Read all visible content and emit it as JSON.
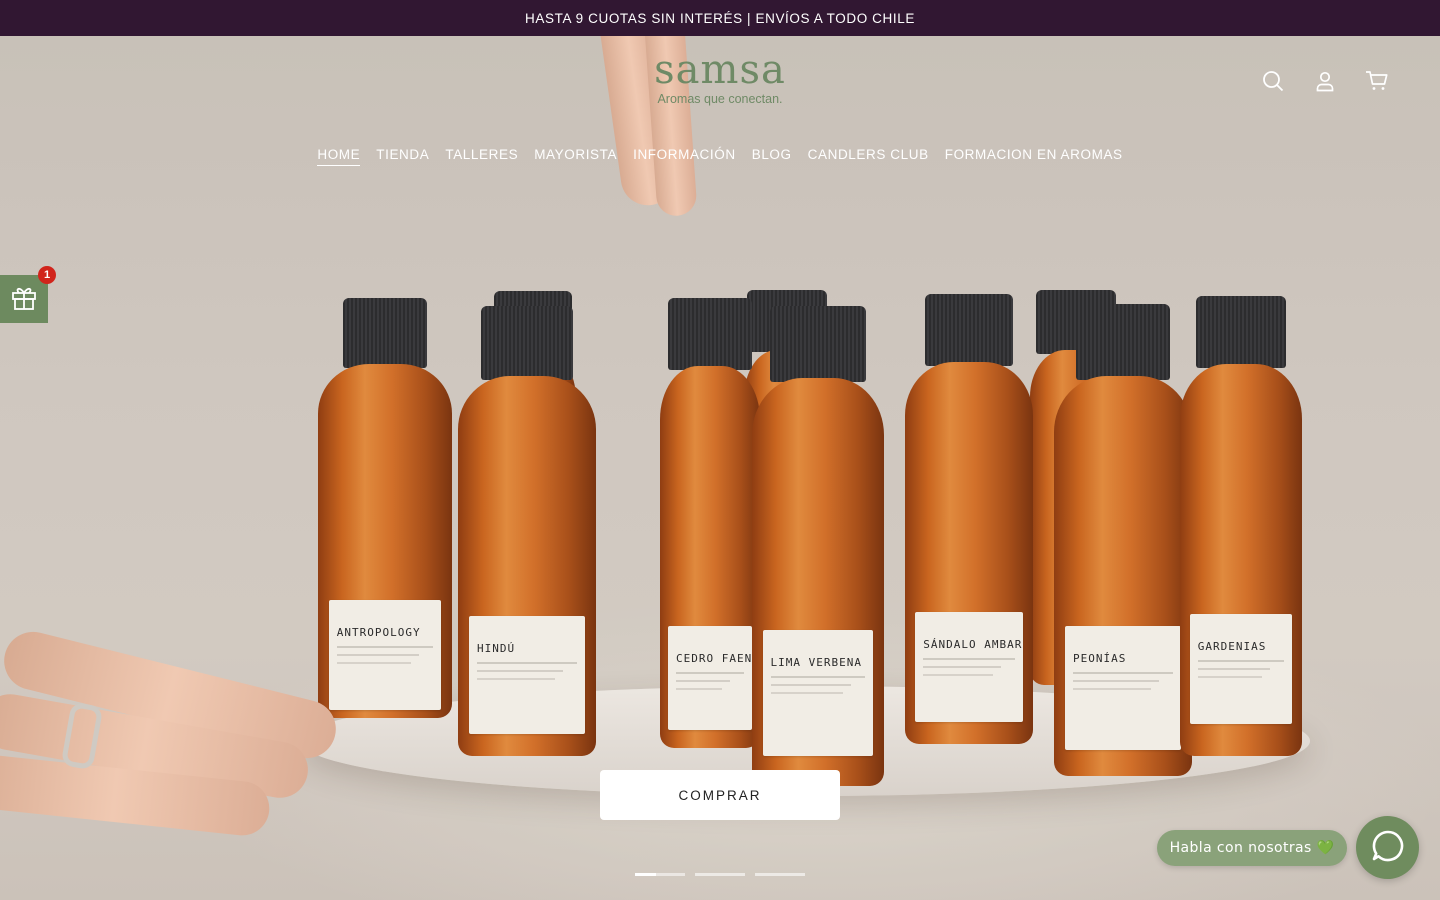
{
  "announcement": "HASTA 9 CUOTAS SIN INTERÉS | ENVÍOS A TODO CHILE",
  "brand": {
    "logo_word": "samsa",
    "logo_tagline": "Aromas que conectan.",
    "accent": "#6f8a66"
  },
  "header_icons": [
    "search-icon",
    "account-icon",
    "cart-icon"
  ],
  "nav": {
    "home": "HOME",
    "tienda": "TIENDA",
    "talleres": "TALLERES",
    "mayorista": "MAYORISTA",
    "informacion": "INFORMACIÓN",
    "blog": "BLOG",
    "candlers": "CANDLERS CLUB",
    "formacion": "FORMACION EN AROMAS"
  },
  "gift_widget": {
    "badge": "1",
    "icon": "gift-icon"
  },
  "hero": {
    "bottles": {
      "b1": "ANTROPOLOGY",
      "b2": "HINDÚ",
      "b3": "CEDRO FAEN",
      "b4": "LIMA VERBENA",
      "b5": "SÁNDALO AMBAR",
      "b6": "PEONÍAS",
      "b7": "GARDENIAS"
    },
    "cta": "COMPRAR",
    "slides_total": 3,
    "slide_active": 1
  },
  "chat": {
    "pill": "Habla con nosotras 💚",
    "icon": "chat-icon"
  },
  "colors": {
    "announcement_bg": "#311732",
    "gift_bg": "#6d8a5f",
    "chat_bg": "#6f8c5e"
  }
}
